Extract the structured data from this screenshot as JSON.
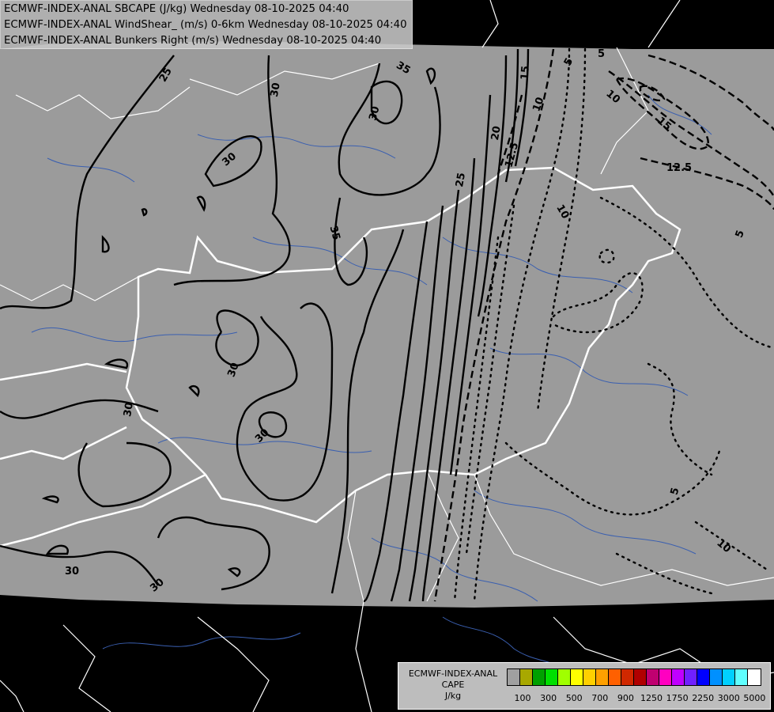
{
  "titles": [
    "ECMWF-INDEX-ANAL SBCAPE (J/kg) Wednesday 08-10-2025 04:40",
    "ECMWF-INDEX-ANAL WindShear_ (m/s) 0-6km Wednesday 08-10-2025 04:40",
    "ECMWF-INDEX-ANAL Bunkers Right (m/s) Wednesday 08-10-2025 04:40"
  ],
  "colors": {
    "map_fill": "#9b9b9b",
    "outside": "#000000",
    "borders": "#ffffff",
    "rivers": "#3a5fb0",
    "contours": "#000000"
  },
  "contour_labels": {
    "wind_shear_solid": [
      "25",
      "30",
      "30",
      "35",
      "30",
      "30",
      "30",
      "30",
      "35",
      "30",
      "30",
      "25",
      "20",
      "15"
    ],
    "bunkers_dashed": [
      "5",
      "5",
      "10",
      "10",
      "15",
      "12.5",
      "12.5",
      "10",
      "5",
      "5",
      "10"
    ]
  },
  "legend": {
    "title_lines": [
      "ECMWF-INDEX-ANAL",
      "CAPE",
      "J/kg"
    ],
    "swatch_colors": [
      "#a0a0a0",
      "#a8a800",
      "#00a000",
      "#00e000",
      "#a0ff00",
      "#ffff00",
      "#ffd000",
      "#ffa000",
      "#ff6000",
      "#d02800",
      "#b00000",
      "#c00070",
      "#ff00c0",
      "#c000ff",
      "#7020ff",
      "#0000ff",
      "#0090ff",
      "#00d0ff",
      "#60ffff",
      "#ffffff"
    ],
    "tick_labels": [
      "100",
      "300",
      "500",
      "700",
      "900",
      "1250",
      "1750",
      "2250",
      "3000",
      "5000"
    ]
  }
}
